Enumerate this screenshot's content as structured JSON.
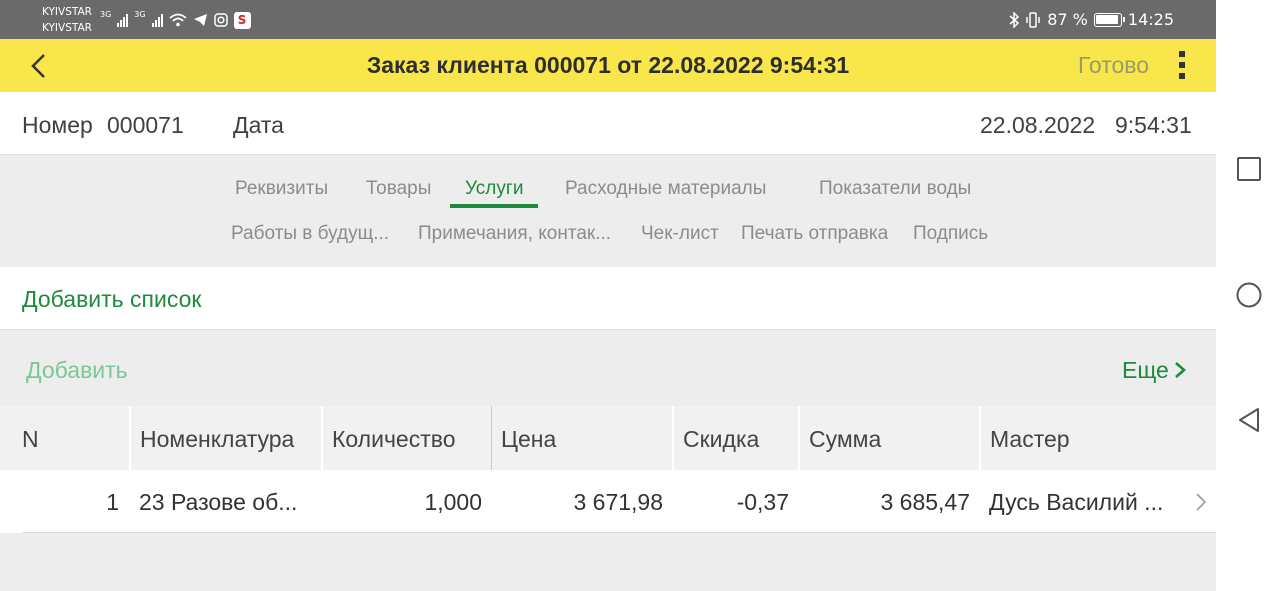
{
  "status_bar": {
    "carrier_1": "KYIVSTAR",
    "carrier_2": "KYIVSTAR",
    "network_1": "3G",
    "network_2": "3G",
    "battery": "87 %",
    "time": "14:25"
  },
  "header": {
    "title": "Заказ клиента 000071 от 22.08.2022 9:54:31",
    "done_label": "Готово",
    "background_color": "#f8e64a"
  },
  "doc": {
    "number_label": "Номер",
    "number_value": "000071",
    "date_label": "Дата",
    "date_value": "22.08.2022",
    "time_value": "9:54:31"
  },
  "tabs": {
    "row1": [
      "Реквизиты",
      "Товары",
      "Услуги",
      "Расходные материалы",
      "Показатели воды"
    ],
    "row2": [
      "Работы в будущ...",
      "Примечания, контак...",
      "Чек-лист",
      "Печать отправка",
      "Подпись"
    ],
    "active": "Услуги",
    "accent_color": "#1e8a3c"
  },
  "actions": {
    "add_list": "Добавить список",
    "add": "Добавить",
    "more": "Еще"
  },
  "table": {
    "columns": [
      "N",
      "Номенклатура",
      "Количество",
      "Цена",
      "Скидка",
      "Сумма",
      "Мастер"
    ],
    "rows": [
      {
        "n": "1",
        "nomenclature": "23 Разове об...",
        "quantity": "1,000",
        "price": "3 671,98",
        "discount": "-0,37",
        "sum": "3 685,47",
        "master": "Дусь Василий ..."
      }
    ]
  },
  "icons": {
    "back": "chevron-left-icon",
    "menu": "more-vert-icon",
    "row": "chevron-right-icon",
    "nav_recent": "square-icon",
    "nav_home": "circle-icon",
    "nav_back": "triangle-back-icon"
  }
}
